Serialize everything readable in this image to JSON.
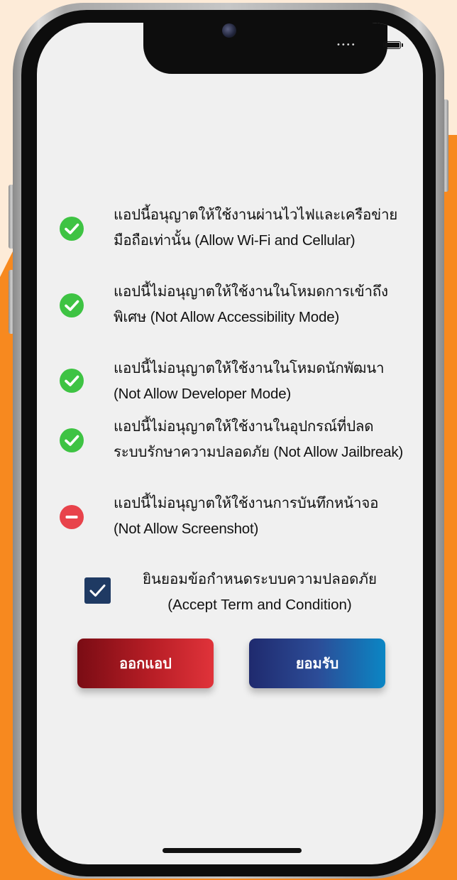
{
  "rules": [
    {
      "text": "แอปนี้อนุญาตให้ใช้งานผ่านไวไฟและเครือข่ายมือถือเท่านั้น (Allow Wi-Fi and Cellular)",
      "status": "ok",
      "icon": "check-circle-icon"
    },
    {
      "text": "แอปนี้ไม่อนุญาตให้ใช้งานในโหมดการเข้าถึงพิเศษ (Not Allow Accessibility Mode)",
      "status": "ok",
      "icon": "check-circle-icon"
    },
    {
      "text": "แอปนี้ไม่อนุญาตให้ใช้งานในโหมดนักพัฒนา (Not Allow Developer Mode)",
      "status": "ok",
      "icon": "check-circle-icon"
    },
    {
      "text": "แอปนี้ไม่อนุญาตให้ใช้งานในอุปกรณ์ที่ปลดระบบรักษาความปลอดภัย (Not Allow Jailbreak)",
      "status": "ok",
      "icon": "check-circle-icon"
    },
    {
      "text": "แอปนี้ไม่อนุญาตให้ใช้งานการบันทึกหน้าจอ (Not Allow Screenshot)",
      "status": "blocked",
      "icon": "minus-circle-icon"
    }
  ],
  "consent": {
    "checked": true,
    "text": "ยินยอมข้อกำหนดระบบความปลอดภัย (Accept Term and Condition)"
  },
  "buttons": {
    "exit_label": "ออกแอป",
    "accept_label": "ยอมรับ"
  },
  "status_bar": {
    "signal_dots": "••••"
  },
  "colors": {
    "ok": "#3ec343",
    "blocked": "#e8434b",
    "checkbox": "#1f3a63",
    "exit_button": "#b81e26",
    "accept_button": "#1f2a6e",
    "background_accent": "#f7891f"
  }
}
